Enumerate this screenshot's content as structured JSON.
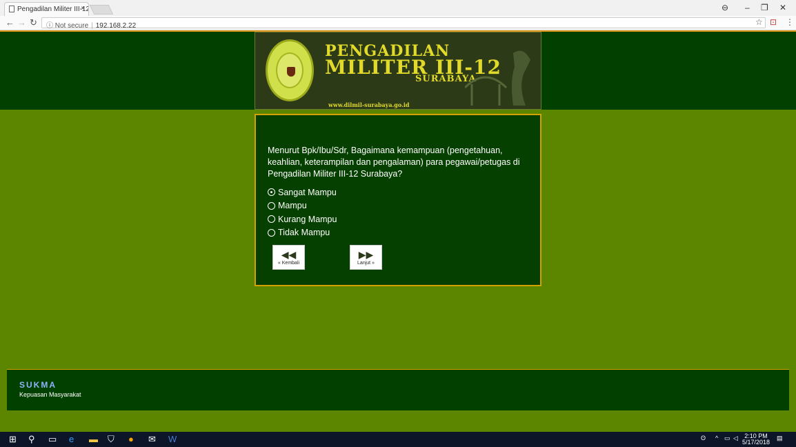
{
  "browser": {
    "tab_title": "Pengadilan Militer III-12",
    "tab_close": "×",
    "address_security": "ⓘ Not secure",
    "address_url": "192.168.2.22",
    "star_icon": "☆",
    "ext_icon": "⊡",
    "menu_icon": "⋮",
    "user_icon": "⊖",
    "minimize": "–",
    "restore": "❐",
    "close": "✕"
  },
  "banner": {
    "line1": "PENGADILAN",
    "line2": "MILITER III-12",
    "line3": "SURABAYA",
    "url": "www.dilmil-surabaya.go.id"
  },
  "survey": {
    "question": "Menurut Bpk/Ibu/Sdr, Bagaimana kemampuan (pengetahuan, keahlian, keterampilan dan pengalaman) para pegawai/petugas di Pengadilan Militer III-12 Surabaya?",
    "options": [
      "Sangat Mampu",
      "Mampu",
      "Kurang Mampu",
      "Tidak Mampu"
    ],
    "prev_label": "« Kembali",
    "next_label": "Lanjut »"
  },
  "footer": {
    "title": "SUKMA",
    "subtitle": "Kepuasan Masyarakat"
  },
  "taskbar": {
    "time": "2:10 PM",
    "date": "5/17/2018"
  },
  "colors": {
    "page_bg": "#5c8600",
    "dark_green": "#024000",
    "border_gold": "#d6a000"
  }
}
